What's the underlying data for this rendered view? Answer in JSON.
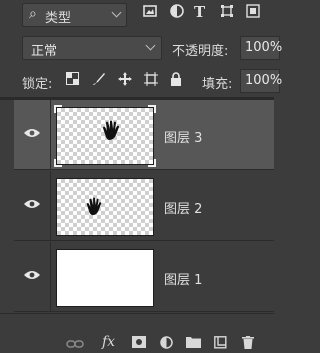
{
  "filter": {
    "label": "类型",
    "icons": [
      "image-filter-icon",
      "adjustment-filter-icon",
      "type-filter-icon",
      "shape-filter-icon",
      "smart-object-filter-icon"
    ]
  },
  "blend": {
    "mode": "正常",
    "opacity_label": "不透明度:",
    "opacity_value": "100%"
  },
  "lock": {
    "label": "锁定:",
    "fill_label": "填充:",
    "fill_value": "100%"
  },
  "layers": [
    {
      "name": "图层 3",
      "selected": true,
      "visible": true,
      "content": "hand-transparent"
    },
    {
      "name": "图层 2",
      "selected": false,
      "visible": true,
      "content": "hand-transparent"
    },
    {
      "name": "图层 1",
      "selected": false,
      "visible": true,
      "content": "white-fill"
    }
  ],
  "toolbar": {
    "fx_label": "fx"
  },
  "colors": {
    "panel": "#3c3c3c",
    "selected_row": "#575757",
    "text": "#dcdcdc"
  }
}
